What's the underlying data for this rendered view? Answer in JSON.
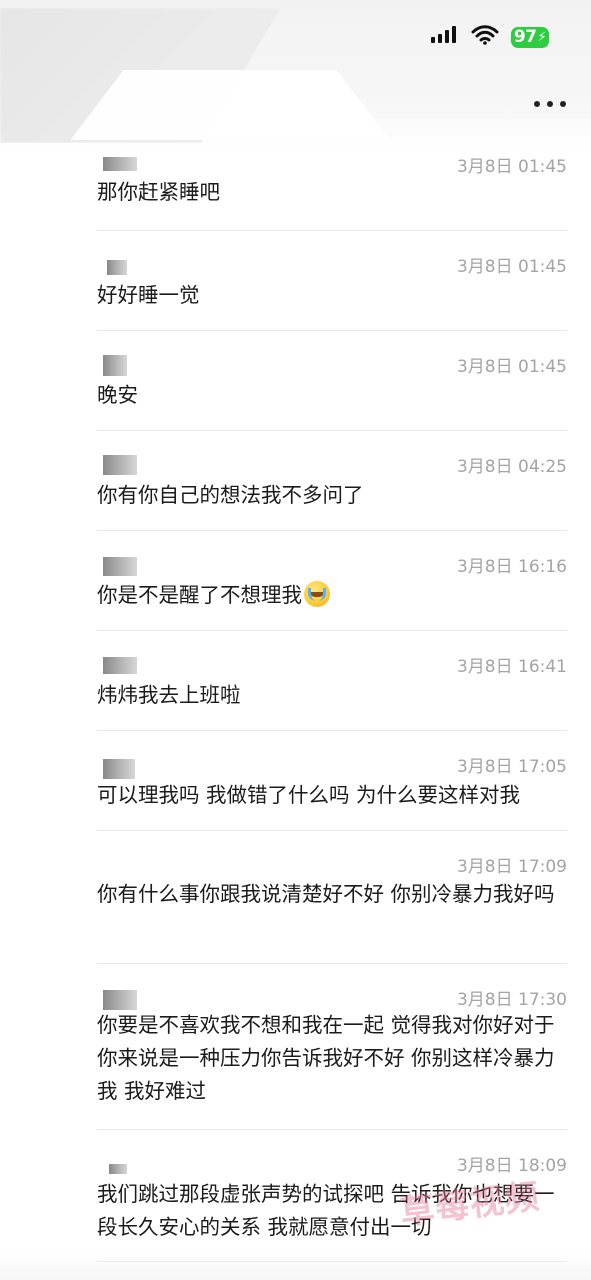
{
  "status_bar": {
    "battery": "97"
  },
  "messages": [
    {
      "time": "3月8日 01:45",
      "text": "那你赶紧睡吧"
    },
    {
      "time": "3月8日 01:45",
      "text": "好好睡一觉"
    },
    {
      "time": "3月8日 01:45",
      "text": "晚安"
    },
    {
      "time": "3月8日 04:25",
      "text": "你有你自己的想法我不多问了"
    },
    {
      "time": "3月8日 16:16",
      "text": "你是不是醒了不想理我"
    },
    {
      "time": "3月8日 16:41",
      "text": "炜炜我去上班啦"
    },
    {
      "time": "3月8日 17:05",
      "text": "可以理我吗 我做错了什么吗 为什么要这样对我"
    },
    {
      "time": "3月8日 17:09",
      "text": "你有什么事你跟我说清楚好不好 你别冷暴力我好吗"
    },
    {
      "time": "3月8日 17:30",
      "text": "你要是不喜欢我不想和我在一起 觉得我对你好对于你来说是一种压力你告诉我好不好 你别这样冷暴力我 我好难过"
    },
    {
      "time": "3月8日 18:09",
      "text": "我们跳过那段虚张声势的试探吧 告诉我你也想要一段长久安心的关系 我就愿意付出一切"
    }
  ],
  "watermark": "草莓视频"
}
